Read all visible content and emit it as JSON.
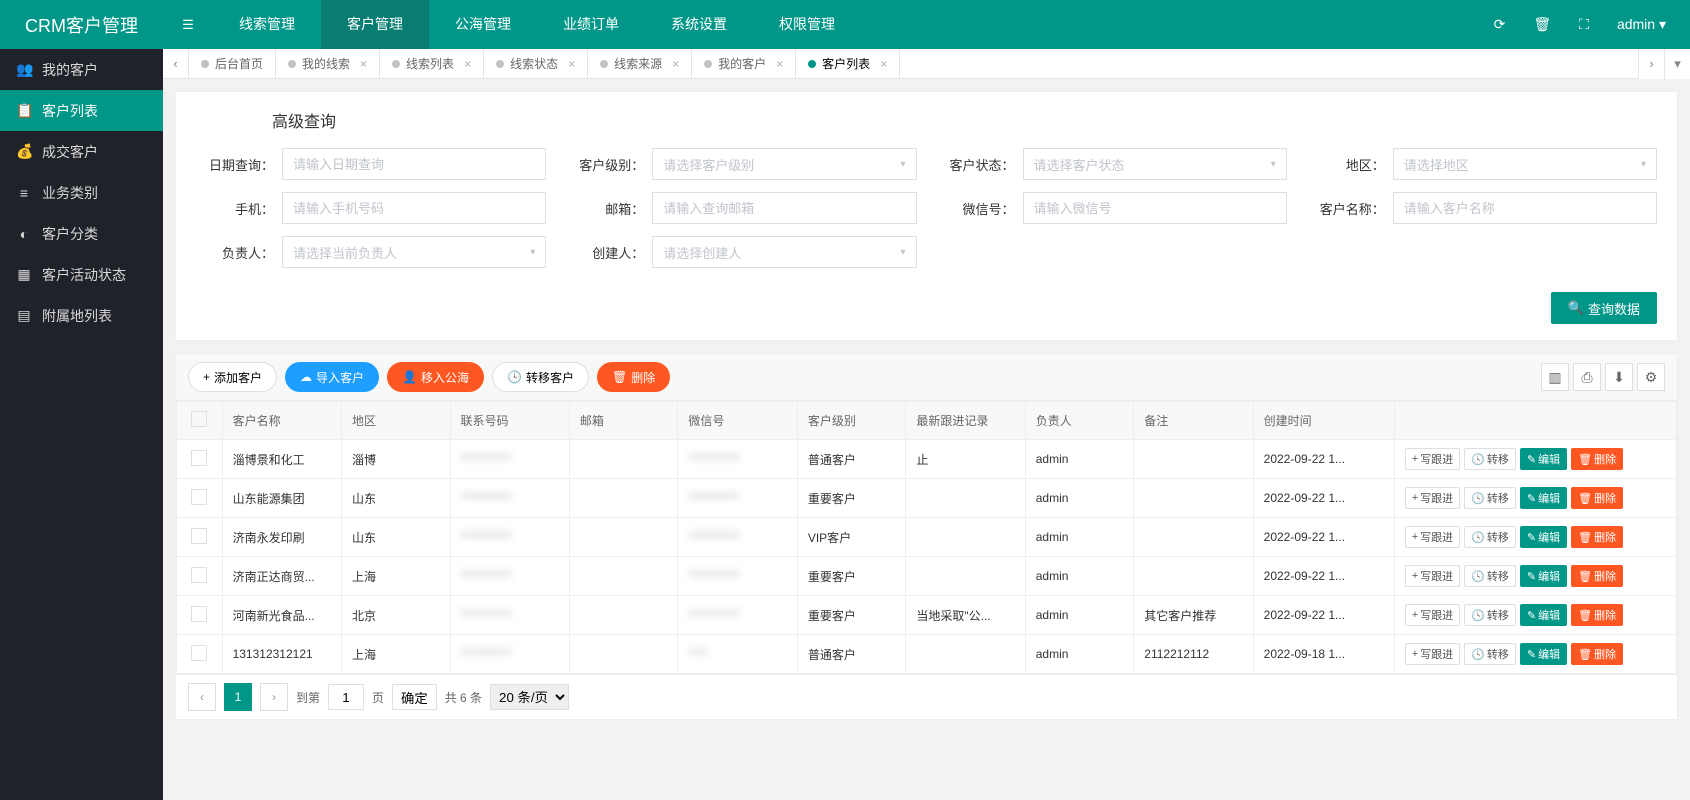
{
  "brand": "CRM客户管理",
  "top_nav": [
    "线索管理",
    "客户管理",
    "公海管理",
    "业绩订单",
    "系统设置",
    "权限管理"
  ],
  "top_nav_active_index": 1,
  "user_name": "admin",
  "sidebar": [
    {
      "icon": "👥",
      "label": "我的客户"
    },
    {
      "icon": "📋",
      "label": "客户列表"
    },
    {
      "icon": "💰",
      "label": "成交客户"
    },
    {
      "icon": "≡",
      "label": "业务类别"
    },
    {
      "icon": "◐",
      "label": "客户分类"
    },
    {
      "icon": "▦",
      "label": "客户活动状态"
    },
    {
      "icon": "▤",
      "label": "附属地列表"
    }
  ],
  "sidebar_active_index": 1,
  "tabs": [
    {
      "label": "后台首页",
      "closable": false
    },
    {
      "label": "我的线索",
      "closable": true
    },
    {
      "label": "线索列表",
      "closable": true
    },
    {
      "label": "线索状态",
      "closable": true
    },
    {
      "label": "线索来源",
      "closable": true
    },
    {
      "label": "我的客户",
      "closable": true
    },
    {
      "label": "客户列表",
      "closable": true
    }
  ],
  "tabs_active_index": 6,
  "query": {
    "title": "高级查询",
    "fields": {
      "date": {
        "label": "日期查询：",
        "placeholder": "请输入日期查询"
      },
      "level": {
        "label": "客户级别：",
        "placeholder": "请选择客户级别"
      },
      "status": {
        "label": "客户状态：",
        "placeholder": "请选择客户状态"
      },
      "region": {
        "label": "地区：",
        "placeholder": "请选择地区"
      },
      "phone": {
        "label": "手机：",
        "placeholder": "请输入手机号码"
      },
      "email": {
        "label": "邮箱：",
        "placeholder": "请输入查询邮箱"
      },
      "wechat": {
        "label": "微信号：",
        "placeholder": "请输入微信号"
      },
      "name": {
        "label": "客户名称：",
        "placeholder": "请输入客户名称"
      },
      "owner": {
        "label": "负责人：",
        "placeholder": "请选择当前负责人"
      },
      "creator": {
        "label": "创建人：",
        "placeholder": "请选择创建人"
      }
    },
    "search_btn": "查询数据"
  },
  "toolbar": {
    "add": "添加客户",
    "import": "导入客户",
    "to_sea": "移入公海",
    "transfer": "转移客户",
    "delete": "删除"
  },
  "table": {
    "headers": [
      "客户名称",
      "地区",
      "联系号码",
      "邮箱",
      "微信号",
      "客户级别",
      "最新跟进记录",
      "负责人",
      "备注",
      "创建时间"
    ],
    "rows": [
      {
        "name": "淄博景和化工",
        "region": "淄博",
        "phone": "***********",
        "email": "",
        "wechat": "***********",
        "level": "普通客户",
        "follow": "止",
        "owner": "admin",
        "remark": "",
        "created": "2022-09-22 1..."
      },
      {
        "name": "山东能源集团",
        "region": "山东",
        "phone": "***********",
        "email": "",
        "wechat": "***********",
        "level": "重要客户",
        "follow": "",
        "owner": "admin",
        "remark": "",
        "created": "2022-09-22 1..."
      },
      {
        "name": "济南永发印刷",
        "region": "山东",
        "phone": "***********",
        "email": "",
        "wechat": "***********",
        "level": "VIP客户",
        "follow": "",
        "owner": "admin",
        "remark": "",
        "created": "2022-09-22 1..."
      },
      {
        "name": "济南正达商贸...",
        "region": "上海",
        "phone": "***********",
        "email": "",
        "wechat": "***********",
        "level": "重要客户",
        "follow": "",
        "owner": "admin",
        "remark": "",
        "created": "2022-09-22 1..."
      },
      {
        "name": "河南新光食品...",
        "region": "北京",
        "phone": "***********",
        "email": "",
        "wechat": "***********",
        "level": "重要客户",
        "follow": "当地采取\"公...",
        "owner": "admin",
        "remark": "其它客户推荐",
        "created": "2022-09-22 1..."
      },
      {
        "name": "131312312121",
        "region": "上海",
        "phone": "***********",
        "email": "",
        "wechat": "****",
        "level": "普通客户",
        "follow": "",
        "owner": "admin",
        "remark": "2112212112",
        "created": "2022-09-18 1..."
      }
    ],
    "ops": {
      "follow": "写跟进",
      "transfer": "转移",
      "edit": "编辑",
      "delete": "删除"
    }
  },
  "pager": {
    "current": "1",
    "goto_prefix": "到第",
    "goto_suffix": "页",
    "goto_value": "1",
    "confirm": "确定",
    "total": "共 6 条",
    "page_size": "20 条/页"
  }
}
